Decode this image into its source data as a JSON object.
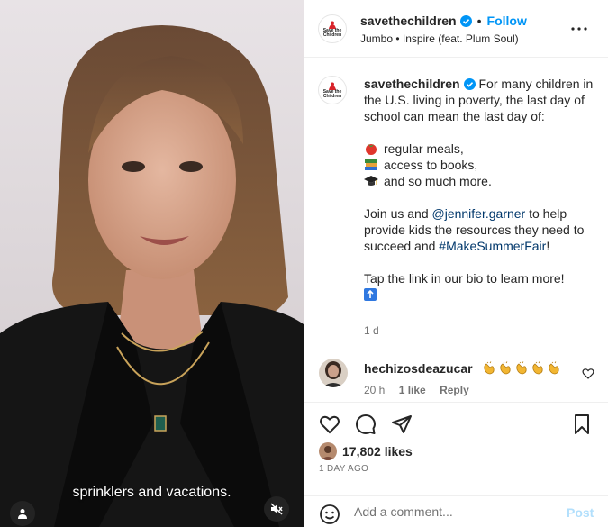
{
  "media": {
    "caption": "sprinklers and vacations.",
    "icons": {
      "tag": "user-tag-icon",
      "mute": "speaker-muted-icon"
    }
  },
  "header": {
    "avatar_text": "Save the Children",
    "username": "savethechildren",
    "separator": "•",
    "follow_label": "Follow",
    "audio": "Jumbo • Inspire (feat. Plum Soul)",
    "icons": {
      "verified": "verified-badge-icon",
      "more": "more-options-icon"
    }
  },
  "post": {
    "username": "savethechildren",
    "intro": "For many children in the U.S. living in poverty, the last day of school can mean the last day of:",
    "list": [
      {
        "icon": "tomato-emoji-icon",
        "text": "regular meals,"
      },
      {
        "icon": "books-emoji-icon",
        "text": "access to books,"
      },
      {
        "icon": "graduation-cap-emoji-icon",
        "text": "and so much more."
      }
    ],
    "join_prefix": "Join us and ",
    "mention": "@jennifer.garner",
    "join_middle": " to help provide kids the resources they need to succeed and ",
    "hashtag": "#MakeSummerFair",
    "join_suffix": "!",
    "cta": "Tap the link in our bio to learn more!",
    "cta_icon": "up-arrow-emoji-icon",
    "age": "1 d"
  },
  "comment": {
    "username": "hechizosdeazucar",
    "emoji_count": 5,
    "emoji_icon": "clapping-hands-emoji-icon",
    "age": "20 h",
    "likes": "1 like",
    "reply": "Reply",
    "icons": {
      "like": "heart-outline-icon"
    }
  },
  "actions": {
    "icons": [
      "heart-icon",
      "comment-icon",
      "share-icon",
      "bookmark-icon"
    ],
    "likes": "17,802 likes",
    "date": "1 DAY AGO"
  },
  "composer": {
    "placeholder": "Add a comment...",
    "post_label": "Post",
    "icons": {
      "emoji": "emoji-smile-icon"
    }
  },
  "colors": {
    "accent": "#0095f6",
    "link": "#00376b",
    "muted": "#737373",
    "post_disabled": "#b2dffc",
    "border": "#efefef"
  }
}
